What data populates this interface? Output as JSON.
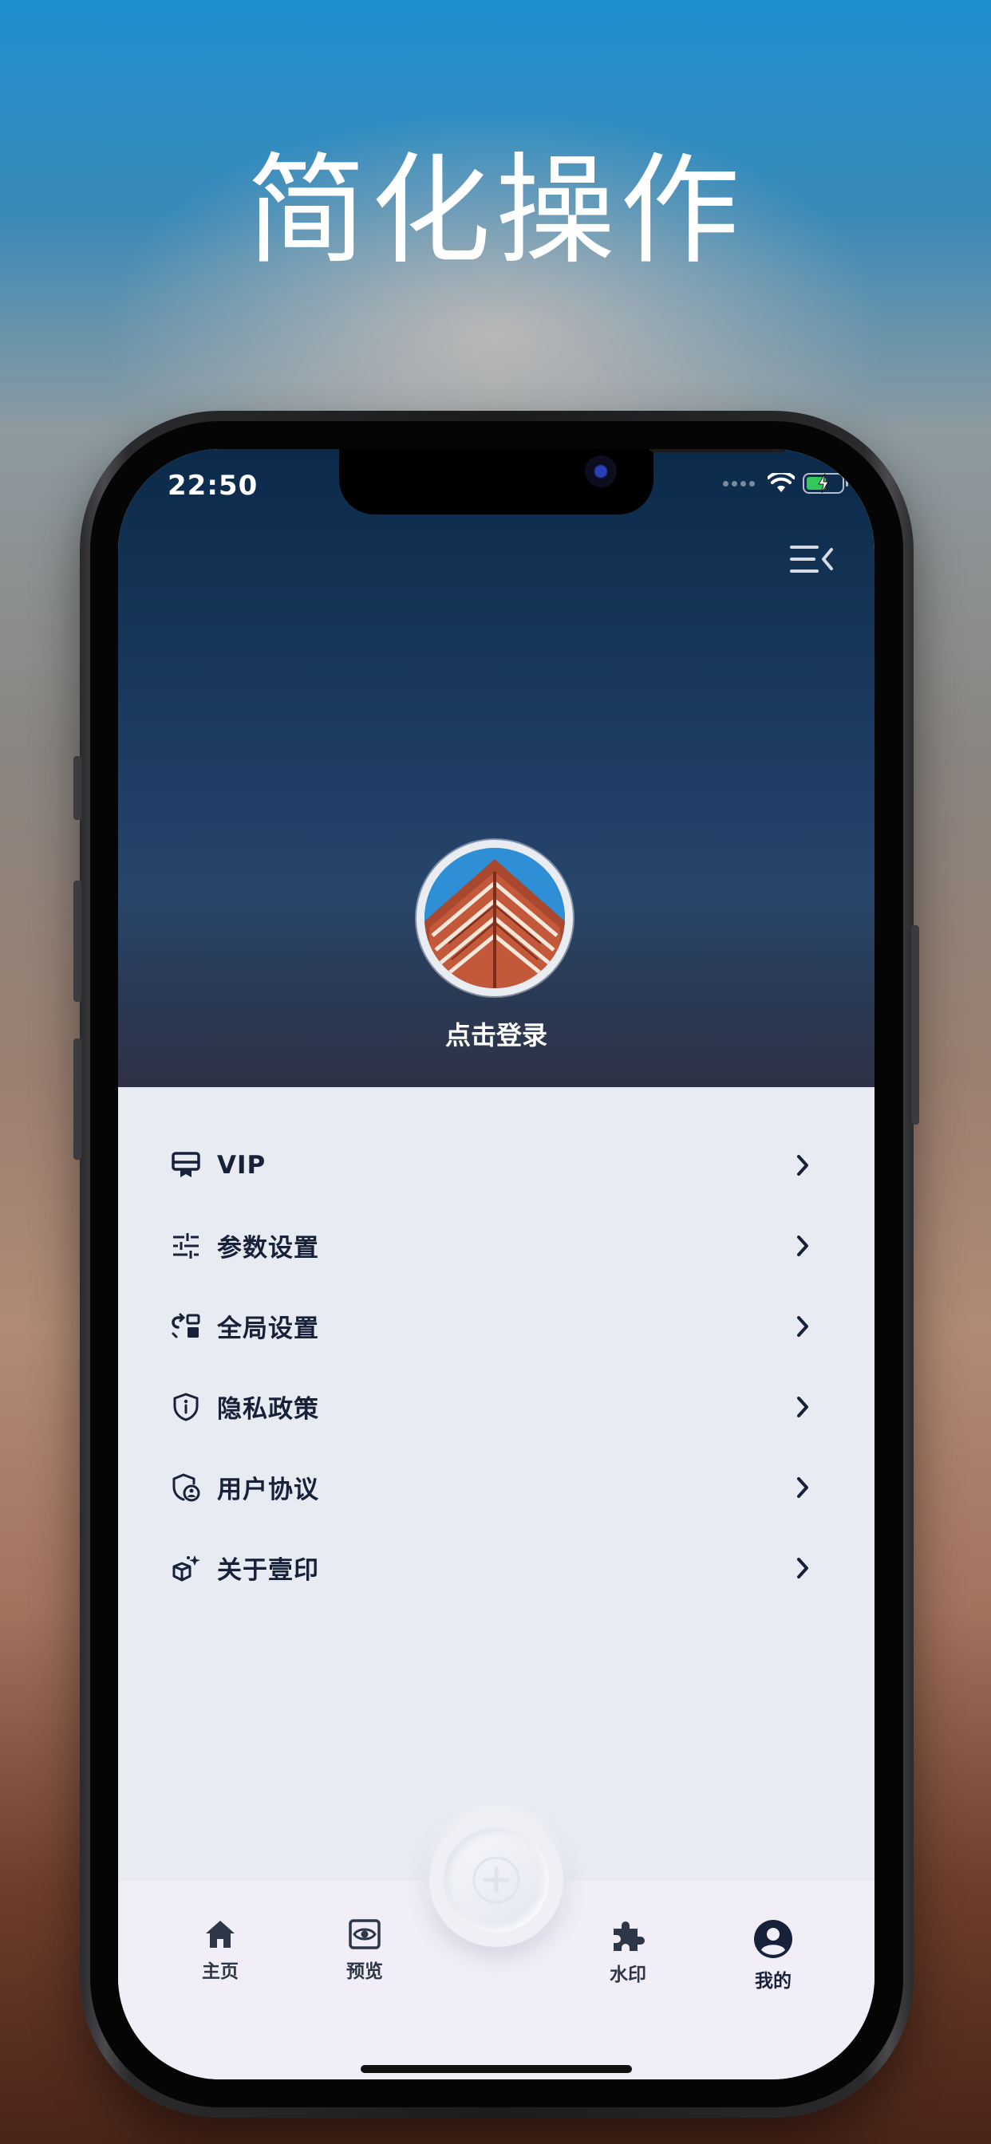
{
  "headline": "简化操作",
  "status_bar": {
    "time": "22:50"
  },
  "profile": {
    "login_label": "点击登录"
  },
  "menu": [
    {
      "label": "VIP",
      "icon": "vip-card-icon"
    },
    {
      "label": "参数设置",
      "icon": "sliders-icon"
    },
    {
      "label": "全局设置",
      "icon": "global-settings-icon"
    },
    {
      "label": "隐私政策",
      "icon": "shield-info-icon"
    },
    {
      "label": "用户协议",
      "icon": "shield-user-icon"
    },
    {
      "label": "关于壹印",
      "icon": "about-icon"
    }
  ],
  "tabbar": {
    "items": [
      {
        "label": "主页",
        "icon": "home-icon"
      },
      {
        "label": "预览",
        "icon": "preview-eye-icon"
      },
      {
        "label": "水印",
        "icon": "puzzle-icon"
      },
      {
        "label": "我的",
        "icon": "user-circle-icon"
      }
    ],
    "center_button_icon": "plus-icon"
  },
  "colors": {
    "accent_text": "#17223a",
    "hero_top": "#0c2a4a",
    "list_background": "#e8ebf2",
    "tabbar_background": "#f1eef8",
    "battery_green": "#34c759"
  }
}
